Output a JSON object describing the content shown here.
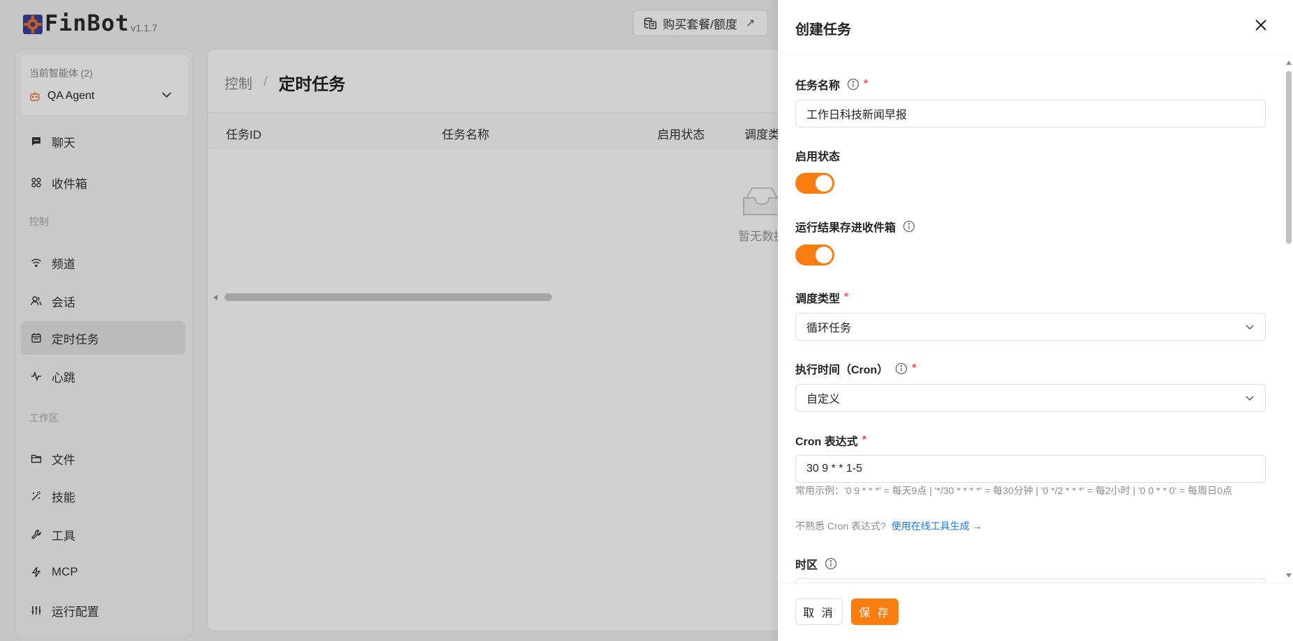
{
  "app": {
    "name": "FinBot",
    "version": "v1.1.7"
  },
  "header": {
    "buy_label": "购买套餐/额度",
    "buy_icon": "coins-icon",
    "external_icon": "arrow-up-right-icon"
  },
  "sidebar": {
    "agent_caption": "当前智能体 (2)",
    "agent_name": "QA Agent",
    "items_top": [
      {
        "label": "聊天",
        "icon": "chat-icon"
      },
      {
        "label": "收件箱",
        "icon": "grid-icon"
      }
    ],
    "section_control": "控制",
    "items_control": [
      {
        "label": "频道",
        "icon": "wifi-icon"
      },
      {
        "label": "会话",
        "icon": "users-icon"
      },
      {
        "label": "定时任务",
        "icon": "calendar-icon",
        "active": true
      },
      {
        "label": "心跳",
        "icon": "pulse-icon"
      }
    ],
    "section_workspace": "工作区",
    "items_workspace": [
      {
        "label": "文件",
        "icon": "folder-icon"
      },
      {
        "label": "技能",
        "icon": "magic-wand-icon"
      },
      {
        "label": "工具",
        "icon": "wrench-icon"
      },
      {
        "label": "MCP",
        "icon": "zap-icon"
      },
      {
        "label": "运行配置",
        "icon": "sliders-icon"
      }
    ]
  },
  "main": {
    "breadcrumb_parent": "控制",
    "breadcrumb_sep": "/",
    "breadcrumb_current": "定时任务",
    "columns": [
      "任务ID",
      "任务名称",
      "启用状态",
      "调度类"
    ],
    "empty_text": "暂无数据"
  },
  "drawer": {
    "title": "创建任务",
    "fields": {
      "task_name": {
        "label": "任务名称",
        "value": "工作日科技新闻早报"
      },
      "enabled": {
        "label": "启用状态",
        "on": true
      },
      "save_inbox": {
        "label": "运行结果存进收件箱",
        "on": true
      },
      "schedule_type": {
        "label": "调度类型",
        "value": "循环任务"
      },
      "exec_time": {
        "label": "执行时间（Cron）",
        "value": "自定义"
      },
      "cron_expr": {
        "label": "Cron 表达式",
        "value": "30 9 * * 1-5",
        "hint": "常用示例：'0 9 * * *' = 每天9点 | '*/30 * * * *' = 每30分钟 | '0 */2 * * *' = 每2小时 | '0 0 * * 0' = 每周日0点",
        "help_prefix": "不熟悉 Cron 表达式?",
        "help_link": "使用在线工具生成 →"
      },
      "timezone": {
        "label": "时区"
      }
    },
    "cancel_label": "取 消",
    "save_label": "保 存"
  },
  "colors": {
    "accent": "#fa7d0f",
    "link": "#1677ff",
    "required": "#ff4d4f"
  }
}
